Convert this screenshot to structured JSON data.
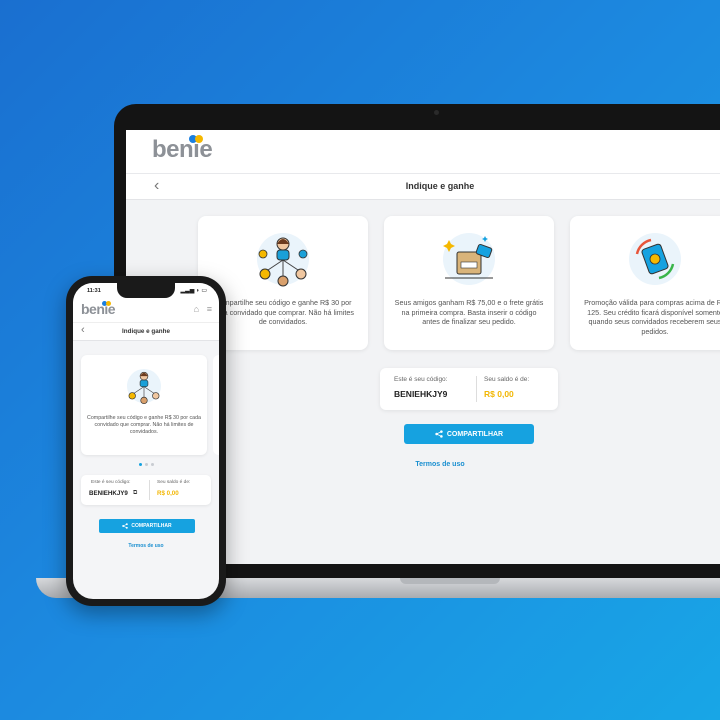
{
  "brand": {
    "logo_text": "benie",
    "dot_colors": [
      "#1a7fe0",
      "#f5b800"
    ]
  },
  "page": {
    "title": "Indique e ganhe"
  },
  "cards": [
    {
      "icon": "people-network-icon",
      "text": "Compartilhe seu código e ganhe R$ 30 por cada convidado que comprar. Não há limites de convidados."
    },
    {
      "icon": "gift-box-icon",
      "text": "Seus amigos ganham R$ 75,00 e o frete grátis na primeira compra. Basta inserir o código antes de finalizar seu pedido."
    },
    {
      "icon": "money-exchange-icon",
      "text": "Promoção válida para compras acima de R$ 125. Seu crédito ficará disponível somente  quando seus convidados receberem seus pedidos."
    }
  ],
  "code_box": {
    "code_label": "Este é seu código:",
    "code": "BENIEHKJY9",
    "balance_label": "Seu saldo é de:",
    "balance": "R$ 0,00"
  },
  "share_button": "COMPARTILHAR",
  "terms_link": "Termos de uso",
  "phone": {
    "time": "11:31",
    "carousel_active_index": 0,
    "carousel_count": 3
  },
  "colors": {
    "accent": "#16a2e0",
    "balance": "#f2b705",
    "background_start": "#1a6fd0",
    "background_end": "#18a6e6"
  }
}
